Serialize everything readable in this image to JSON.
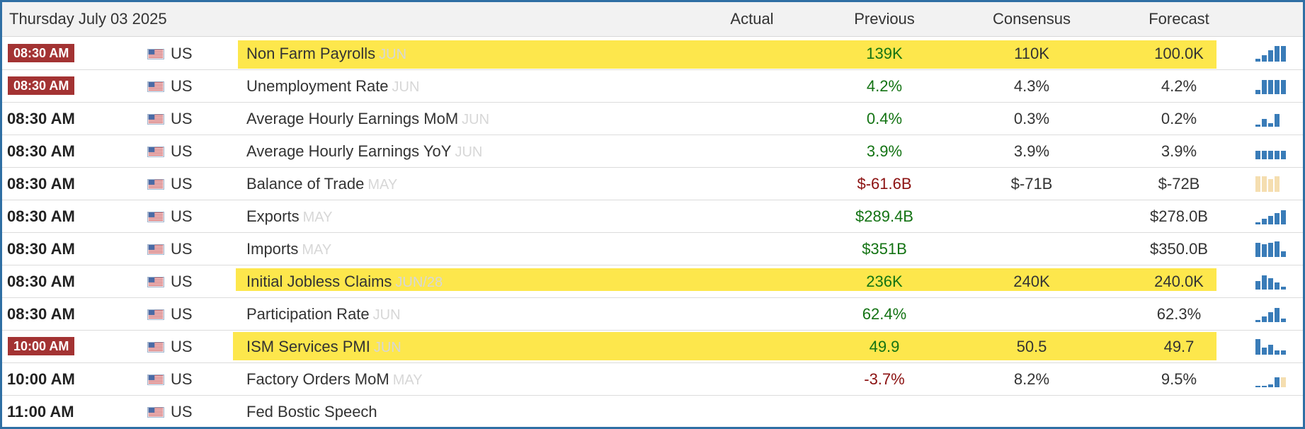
{
  "header": {
    "date": "Thursday July 03 2025",
    "columns": {
      "actual": "Actual",
      "previous": "Previous",
      "consensus": "Consensus",
      "forecast": "Forecast"
    }
  },
  "colors": {
    "highlight": "#fde74c",
    "badge": "#a33333",
    "positive": "#137313",
    "negative": "#8b1111",
    "spark_blue": "#3a7cb8",
    "spark_beige": "#f5deb0",
    "frame": "#2f6fa4"
  },
  "rows": [
    {
      "time": "08:30 AM",
      "badge": true,
      "country": "US",
      "event": "Non Farm Payrolls",
      "ref": "JUN",
      "actual": "",
      "previous": "139K",
      "previous_color": "green",
      "consensus": "110K",
      "forecast": "100.0K",
      "highlight": true,
      "spark_icon": "bar-chart-icon"
    },
    {
      "time": "08:30 AM",
      "badge": true,
      "country": "US",
      "event": "Unemployment Rate",
      "ref": "JUN",
      "actual": "",
      "previous": "4.2%",
      "previous_color": "green",
      "consensus": "4.3%",
      "forecast": "4.2%",
      "highlight": false,
      "spark_icon": "bar-chart-icon"
    },
    {
      "time": "08:30 AM",
      "badge": false,
      "country": "US",
      "event": "Average Hourly Earnings MoM",
      "ref": "JUN",
      "actual": "",
      "previous": "0.4%",
      "previous_color": "green",
      "consensus": "0.3%",
      "forecast": "0.2%",
      "highlight": false,
      "spark_icon": "bar-chart-icon"
    },
    {
      "time": "08:30 AM",
      "badge": false,
      "country": "US",
      "event": "Average Hourly Earnings YoY",
      "ref": "JUN",
      "actual": "",
      "previous": "3.9%",
      "previous_color": "green",
      "consensus": "3.9%",
      "forecast": "3.9%",
      "highlight": false,
      "spark_icon": "bar-chart-icon"
    },
    {
      "time": "08:30 AM",
      "badge": false,
      "country": "US",
      "event": "Balance of Trade",
      "ref": "MAY",
      "actual": "",
      "previous": "$-61.6B",
      "previous_color": "red",
      "consensus": "$-71B",
      "forecast": "$-72B",
      "highlight": false,
      "spark_icon": "bar-chart-icon"
    },
    {
      "time": "08:30 AM",
      "badge": false,
      "country": "US",
      "event": "Exports",
      "ref": "MAY",
      "actual": "",
      "previous": "$289.4B",
      "previous_color": "green",
      "consensus": "",
      "forecast": "$278.0B",
      "highlight": false,
      "spark_icon": "bar-chart-icon"
    },
    {
      "time": "08:30 AM",
      "badge": false,
      "country": "US",
      "event": "Imports",
      "ref": "MAY",
      "actual": "",
      "previous": "$351B",
      "previous_color": "green",
      "consensus": "",
      "forecast": "$350.0B",
      "highlight": false,
      "spark_icon": "bar-chart-icon"
    },
    {
      "time": "08:30 AM",
      "badge": false,
      "country": "US",
      "event": "Initial Jobless Claims",
      "ref": "JUN/28",
      "actual": "",
      "previous": "236K",
      "previous_color": "green",
      "consensus": "240K",
      "forecast": "240.0K",
      "highlight": true,
      "spark_icon": "bar-chart-icon"
    },
    {
      "time": "08:30 AM",
      "badge": false,
      "country": "US",
      "event": "Participation Rate",
      "ref": "JUN",
      "actual": "",
      "previous": "62.4%",
      "previous_color": "green",
      "consensus": "",
      "forecast": "62.3%",
      "highlight": false,
      "spark_icon": "bar-chart-icon"
    },
    {
      "time": "10:00 AM",
      "badge": true,
      "country": "US",
      "event": "ISM Services PMI",
      "ref": "JUN",
      "actual": "",
      "previous": "49.9",
      "previous_color": "green",
      "consensus": "50.5",
      "forecast": "49.7",
      "highlight": true,
      "spark_icon": "bar-chart-icon"
    },
    {
      "time": "10:00 AM",
      "badge": false,
      "country": "US",
      "event": "Factory Orders MoM",
      "ref": "MAY",
      "actual": "",
      "previous": "-3.7%",
      "previous_color": "red",
      "consensus": "8.2%",
      "forecast": "9.5%",
      "highlight": false,
      "spark_icon": "bar-chart-icon"
    },
    {
      "time": "11:00 AM",
      "badge": false,
      "country": "US",
      "event": "Fed Bostic Speech",
      "ref": "",
      "actual": "",
      "previous": "",
      "previous_color": "green",
      "consensus": "",
      "forecast": "",
      "highlight": false,
      "spark_icon": ""
    }
  ]
}
